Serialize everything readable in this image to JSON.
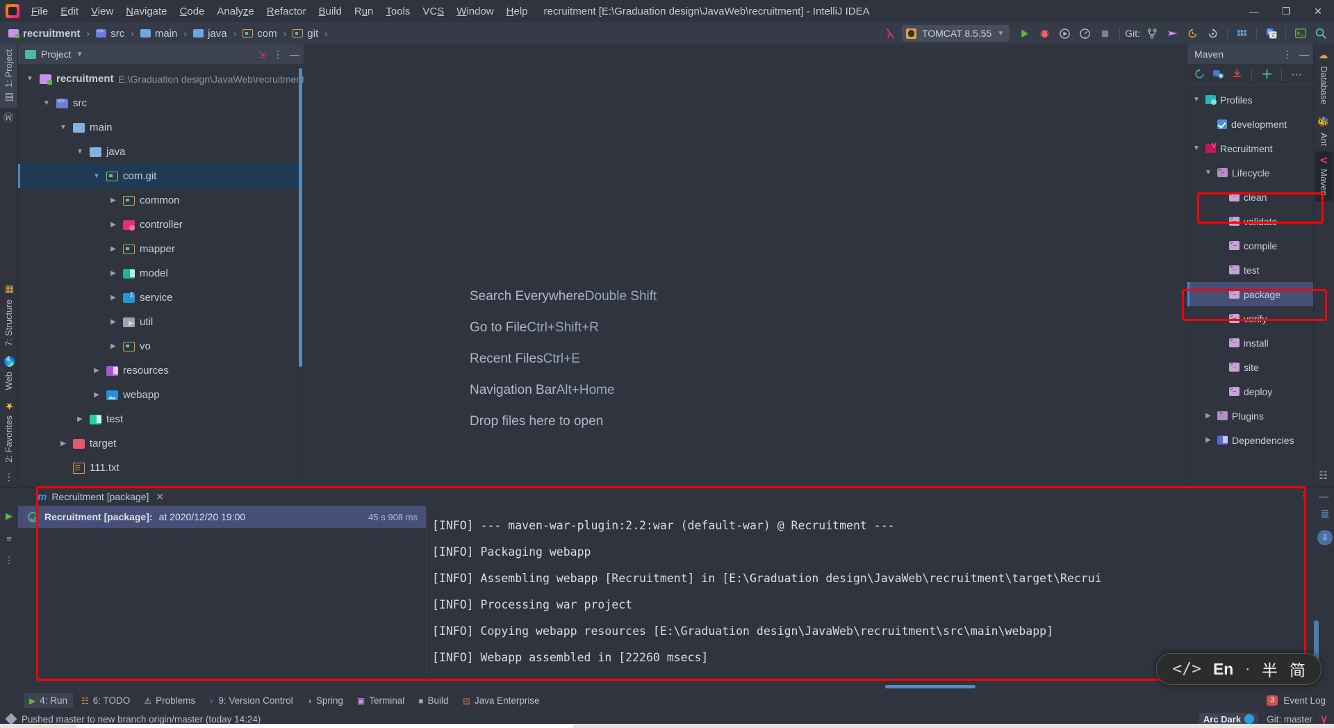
{
  "window": {
    "title": "recruitment [E:\\Graduation design\\JavaWeb\\recruitment] - IntelliJ IDEA",
    "minimize": "—",
    "maximize": "❐",
    "close": "✕"
  },
  "menu": [
    {
      "label": "File"
    },
    {
      "label": "Edit"
    },
    {
      "label": "View"
    },
    {
      "label": "Navigate"
    },
    {
      "label": "Code"
    },
    {
      "label": "Analyze"
    },
    {
      "label": "Refactor"
    },
    {
      "label": "Build"
    },
    {
      "label": "Run"
    },
    {
      "label": "Tools"
    },
    {
      "label": "VCS"
    },
    {
      "label": "Window"
    },
    {
      "label": "Help"
    }
  ],
  "navbar": {
    "crumbs": [
      "recruitment",
      "src",
      "main",
      "java",
      "com",
      "git"
    ],
    "separator": "›",
    "run_config": "TOMCAT 8.5.55",
    "git_label": "Git:"
  },
  "project_panel": {
    "title": "Project",
    "tree": [
      {
        "name": "recruitment",
        "path": "E:\\Graduation design\\JavaWeb\\recruitment",
        "indent": 0,
        "arrow": "▼",
        "icon": "modroot",
        "bold": true
      },
      {
        "name": "src",
        "path": "",
        "indent": 1,
        "arrow": "▼",
        "icon": "srcroot",
        "bold": false
      },
      {
        "name": "main",
        "path": "",
        "indent": 2,
        "arrow": "▼",
        "icon": "folder",
        "bold": false
      },
      {
        "name": "java",
        "path": "",
        "indent": 3,
        "arrow": "▼",
        "icon": "folder",
        "bold": false
      },
      {
        "name": "com.git",
        "path": "",
        "indent": 4,
        "arrow": "▼",
        "icon": "pkgf",
        "bold": false,
        "selected": true
      },
      {
        "name": "common",
        "path": "",
        "indent": 5,
        "arrow": "▶",
        "icon": "pkgf",
        "bold": false
      },
      {
        "name": "controller",
        "path": "",
        "indent": 5,
        "arrow": "▶",
        "icon": "ctrl",
        "bold": false
      },
      {
        "name": "mapper",
        "path": "",
        "indent": 5,
        "arrow": "▶",
        "icon": "pkgf",
        "bold": false
      },
      {
        "name": "model",
        "path": "",
        "indent": 5,
        "arrow": "▶",
        "icon": "model",
        "bold": false
      },
      {
        "name": "service",
        "path": "",
        "indent": 5,
        "arrow": "▶",
        "icon": "service",
        "bold": false
      },
      {
        "name": "util",
        "path": "",
        "indent": 5,
        "arrow": "▶",
        "icon": "util",
        "bold": false
      },
      {
        "name": "vo",
        "path": "",
        "indent": 5,
        "arrow": "▶",
        "icon": "pkgf",
        "bold": false
      },
      {
        "name": "resources",
        "path": "",
        "indent": 4,
        "arrow": "▶",
        "icon": "res",
        "bold": false
      },
      {
        "name": "webapp",
        "path": "",
        "indent": 4,
        "arrow": "▶",
        "icon": "webapp",
        "bold": false
      },
      {
        "name": "test",
        "path": "",
        "indent": 3,
        "arrow": "▶",
        "icon": "test",
        "bold": false
      },
      {
        "name": "target",
        "path": "",
        "indent": 2,
        "arrow": "▶",
        "icon": "target",
        "bold": false
      },
      {
        "name": "111.txt",
        "path": "",
        "indent": 2,
        "arrow": "none",
        "icon": "txt",
        "bold": false
      }
    ]
  },
  "editor": {
    "hints": [
      {
        "action": "Search Everywhere",
        "shortcut": "Double Shift"
      },
      {
        "action": "Go to File",
        "shortcut": "Ctrl+Shift+R"
      },
      {
        "action": "Recent Files",
        "shortcut": "Ctrl+E"
      },
      {
        "action": "Navigation Bar",
        "shortcut": "Alt+Home"
      },
      {
        "action": "Drop files here to open",
        "shortcut": ""
      }
    ]
  },
  "maven_panel": {
    "title": "Maven",
    "tree": [
      {
        "name": "Profiles",
        "indent": 0,
        "arrow": "▼",
        "icon": "profiles"
      },
      {
        "name": "development",
        "indent": 1,
        "arrow": "none",
        "icon": "checkbox"
      },
      {
        "name": "Recruitment",
        "indent": 0,
        "arrow": "▼",
        "icon": "mvnproj"
      },
      {
        "name": "Lifecycle",
        "indent": 1,
        "arrow": "▼",
        "icon": "lifecycle"
      },
      {
        "name": "clean",
        "indent": 2,
        "arrow": "none",
        "icon": "goal",
        "annotated": true
      },
      {
        "name": "validate",
        "indent": 2,
        "arrow": "none",
        "icon": "goal"
      },
      {
        "name": "compile",
        "indent": 2,
        "arrow": "none",
        "icon": "goal"
      },
      {
        "name": "test",
        "indent": 2,
        "arrow": "none",
        "icon": "goal"
      },
      {
        "name": "package",
        "indent": 2,
        "arrow": "none",
        "icon": "goal",
        "selected": true,
        "annotated": true
      },
      {
        "name": "verify",
        "indent": 2,
        "arrow": "none",
        "icon": "goal"
      },
      {
        "name": "install",
        "indent": 2,
        "arrow": "none",
        "icon": "goal"
      },
      {
        "name": "site",
        "indent": 2,
        "arrow": "none",
        "icon": "goal"
      },
      {
        "name": "deploy",
        "indent": 2,
        "arrow": "none",
        "icon": "goal"
      },
      {
        "name": "Plugins",
        "indent": 1,
        "arrow": "▶",
        "icon": "plugins"
      },
      {
        "name": "Dependencies",
        "indent": 1,
        "arrow": "▶",
        "icon": "deps"
      }
    ]
  },
  "left_strip": {
    "top": [
      {
        "label": "1: Project",
        "active": true
      },
      {
        "label": "M",
        "active": false
      }
    ],
    "bottom": [
      {
        "label": "7: Structure"
      },
      {
        "label": "Web"
      },
      {
        "label": "2: Favorites"
      }
    ]
  },
  "right_strip": [
    {
      "label": "Database",
      "active": false
    },
    {
      "label": "Ant",
      "active": false
    },
    {
      "label": "Maven",
      "active": true
    }
  ],
  "run_panel": {
    "tab_label": "Recruitment [package]",
    "entry_title": "Recruitment [package]:",
    "entry_time": "at 2020/12/20 19:00",
    "entry_duration": "45 s 908 ms",
    "console_lines": [
      "[INFO] --- maven-war-plugin:2.2:war (default-war) @ Recruitment ---",
      "[INFO] Packaging webapp",
      "[INFO] Assembling webapp [Recruitment] in [E:\\Graduation design\\JavaWeb\\recruitment\\target\\Recrui",
      "[INFO] Processing war project",
      "[INFO] Copying webapp resources [E:\\Graduation design\\JavaWeb\\recruitment\\src\\main\\webapp]",
      "[INFO] Webapp assembled in [22260 msecs]"
    ]
  },
  "toolwindow_bar": {
    "items": [
      {
        "label": "4: Run",
        "active": true
      },
      {
        "label": "6: TODO",
        "active": false
      },
      {
        "label": "Problems",
        "active": false
      },
      {
        "label": "9: Version Control",
        "active": false
      },
      {
        "label": "Spring",
        "active": false
      },
      {
        "label": "Terminal",
        "active": false
      },
      {
        "label": "Build",
        "active": false
      },
      {
        "label": "Java Enterprise",
        "active": false
      }
    ],
    "event_log": "Event Log",
    "event_count": "3"
  },
  "status_bar": {
    "message": "Pushed master to new branch origin/master (today 14:24)",
    "theme": "Arc Dark",
    "git_branch": "Git: master"
  },
  "ime": {
    "code": "</>",
    "lang": "En",
    "dot": "·",
    "width_mode": "半",
    "char_mode": "简"
  },
  "colors": {
    "accent_red": "#ff0000",
    "selection_blue": "#1f3b54",
    "maven_selection": "#474e78",
    "background": "#2f343f"
  }
}
